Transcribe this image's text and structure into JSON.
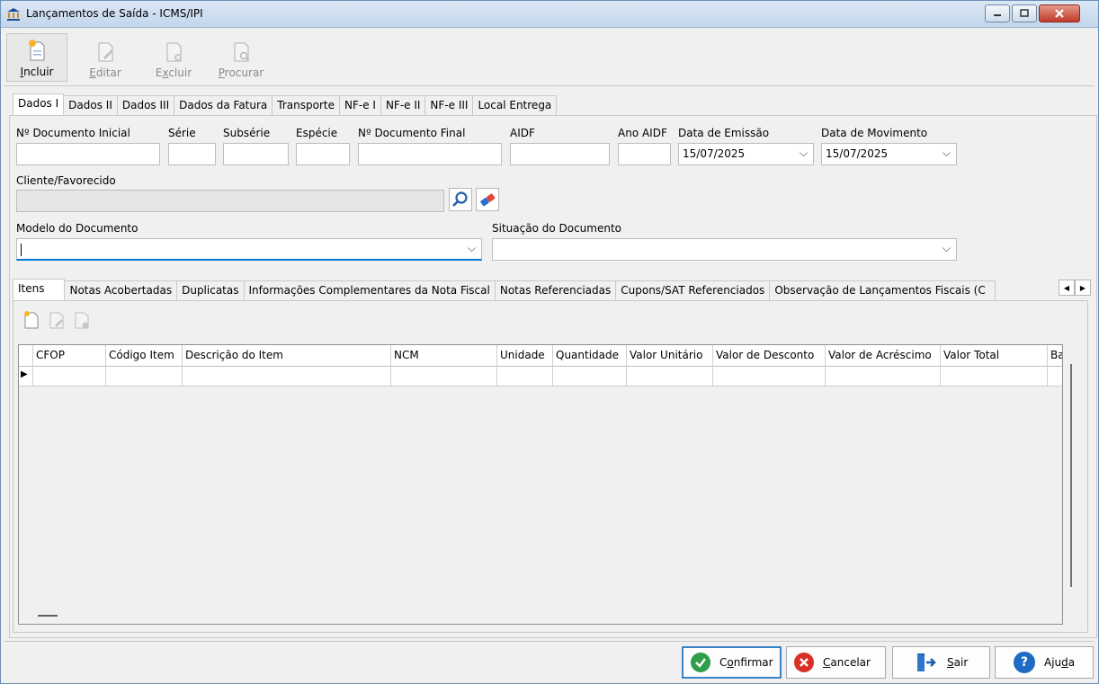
{
  "window": {
    "title": "Lançamentos de Saída - ICMS/IPI"
  },
  "toolbar": {
    "incluir": {
      "pre": "",
      "key": "I",
      "post": "ncluir"
    },
    "editar": {
      "pre": "",
      "key": "E",
      "post": "ditar"
    },
    "excluir": {
      "pre": "E",
      "key": "x",
      "post": "cluir"
    },
    "procurar": {
      "pre": "",
      "key": "P",
      "post": "rocurar"
    }
  },
  "top_tabs": [
    "Dados I",
    "Dados II",
    "Dados III",
    "Dados da Fatura",
    "Transporte",
    "NF-e I",
    "NF-e II",
    "NF-e III",
    "Local Entrega"
  ],
  "form": {
    "doc_inicial_label": "Nº Documento Inicial",
    "serie_label": "Série",
    "subserie_label": "Subsérie",
    "especie_label": "Espécie",
    "doc_final_label": "Nº Documento Final",
    "aidf_label": "AIDF",
    "ano_aidf_label": "Ano AIDF",
    "data_emissao_label": "Data de Emissão",
    "data_emissao_value": "15/07/2025",
    "data_movimento_label": "Data de Movimento",
    "data_movimento_value": "15/07/2025",
    "cliente_label": "Cliente/Favorecido",
    "modelo_label": "Modelo do Documento",
    "situacao_label": "Situação do Documento"
  },
  "bottom_tabs": [
    "Itens",
    "Notas Acobertadas",
    "Duplicatas",
    "Informações Complementares da Nota Fiscal",
    "Notas Referenciadas",
    "Cupons/SAT Referenciados",
    "Observação de Lançamentos Fiscais (C"
  ],
  "grid": {
    "columns": [
      "CFOP",
      "Código Item",
      "Descrição do Item",
      "NCM",
      "Unidade",
      "Quantidade",
      "Valor Unitário",
      "Valor de Desconto",
      "Valor de Acréscimo",
      "Valor Total",
      "Ba"
    ],
    "row_indicator": "▶"
  },
  "buttons": {
    "confirmar": {
      "pre": "C",
      "key": "o",
      "post": "nfirmar"
    },
    "cancelar": {
      "pre": "",
      "key": "C",
      "post": "ancelar"
    },
    "sair": {
      "pre": "",
      "key": "S",
      "post": "air"
    },
    "ajuda": {
      "pre": "Aju",
      "key": "d",
      "post": "a"
    }
  },
  "colors": {
    "accent": "#0078d7",
    "confirm_green": "#2e9e4a",
    "cancel_red": "#d93025",
    "help_blue": "#1e6bc4"
  }
}
